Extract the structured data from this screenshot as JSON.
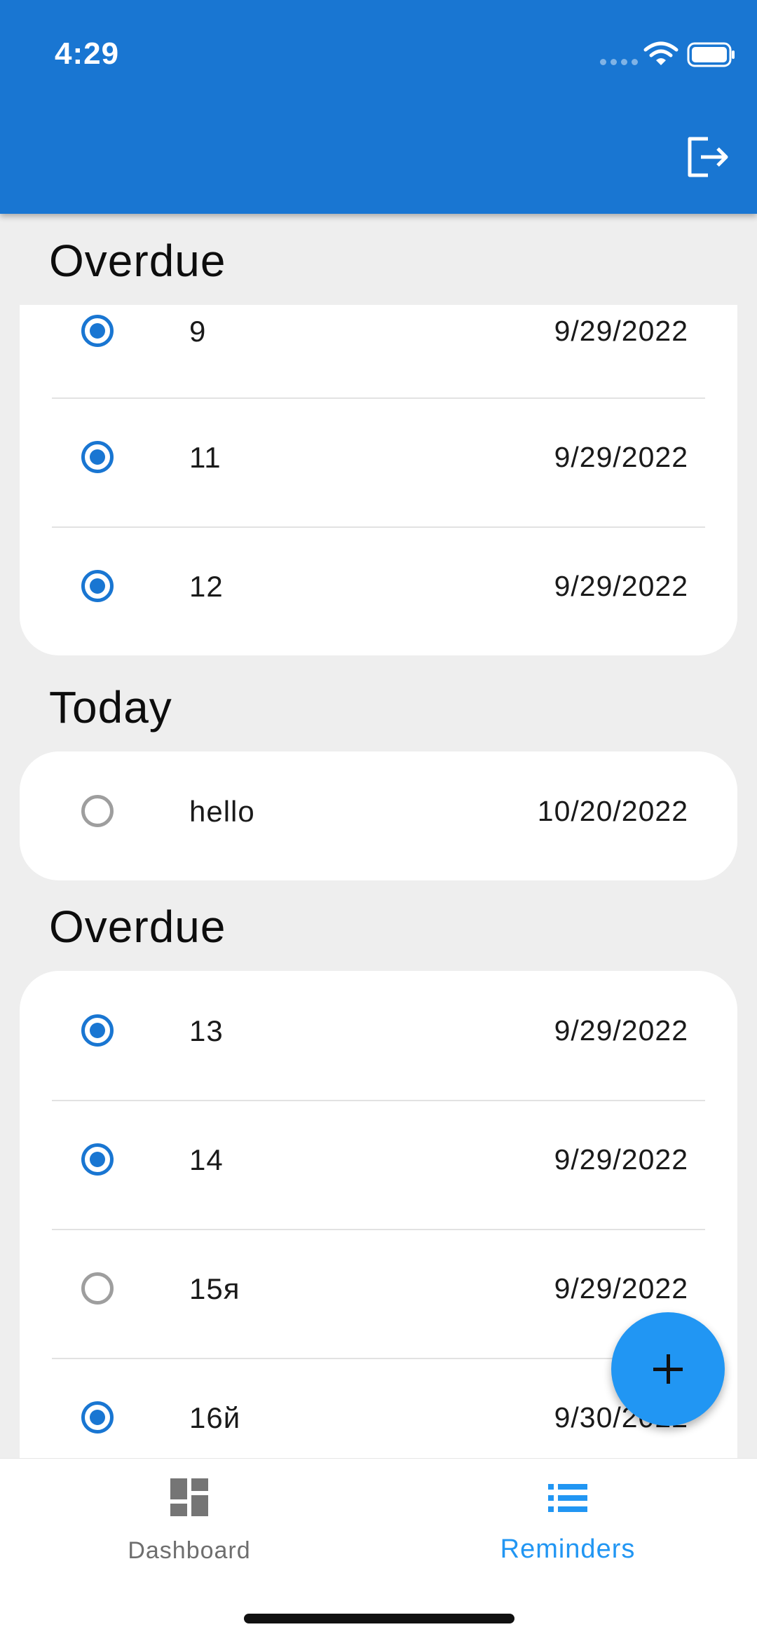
{
  "status_bar": {
    "time": "4:29"
  },
  "app_bar": {
    "logout_icon": "logout-icon"
  },
  "sections": [
    {
      "title": "Overdue",
      "items": [
        {
          "title": "9",
          "date": "9/29/2022",
          "checked": true
        },
        {
          "title": "11",
          "date": "9/29/2022",
          "checked": true
        },
        {
          "title": "12",
          "date": "9/29/2022",
          "checked": true
        }
      ]
    },
    {
      "title": "Today",
      "items": [
        {
          "title": "hello",
          "date": "10/20/2022",
          "checked": false
        }
      ]
    },
    {
      "title": "Overdue",
      "items": [
        {
          "title": "13",
          "date": "9/29/2022",
          "checked": true
        },
        {
          "title": "14",
          "date": "9/29/2022",
          "checked": true
        },
        {
          "title": "15я",
          "date": "9/29/2022",
          "checked": false
        },
        {
          "title": "16й",
          "date": "9/30/2022",
          "checked": true
        }
      ]
    }
  ],
  "fab": {
    "icon": "plus-icon"
  },
  "bottom_nav": {
    "items": [
      {
        "label": "Dashboard",
        "icon": "dashboard-icon",
        "active": false
      },
      {
        "label": "Reminders",
        "icon": "list-icon",
        "active": true
      }
    ]
  },
  "colors": {
    "primary": "#1976d2",
    "accent": "#2196f3",
    "background": "#eeeeee"
  }
}
